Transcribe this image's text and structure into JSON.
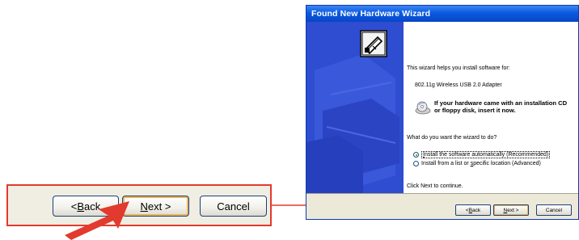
{
  "callout": {
    "back": {
      "pre": "< ",
      "mn": "B",
      "rest": "ack"
    },
    "next": {
      "mn": "N",
      "rest": "ext >"
    },
    "cancel": "Cancel"
  },
  "wizard": {
    "title": "Found New Hardware Wizard",
    "intro": "This wizard helps you install software for:",
    "device": "802.11g Wireless USB 2.0 Adapter",
    "cd_line1": "If your hardware came with an installation CD",
    "cd_line2": "or floppy disk, insert it now.",
    "question": "What do you want the wizard to do?",
    "options": [
      {
        "pre": "",
        "mn": "I",
        "rest": "nstall the software automatically (Recommended)",
        "selected": true
      },
      {
        "pre": "Install from a list or ",
        "mn": "s",
        "rest": "pecific location (Advanced)",
        "selected": false
      }
    ],
    "continue": "Click Next to continue.",
    "buttons": {
      "back": {
        "pre": "< ",
        "mn": "B",
        "rest": "ack"
      },
      "next": {
        "mn": "N",
        "rest": "ext >"
      },
      "cancel": "Cancel"
    }
  },
  "colors": {
    "callout_border": "#e23a2e",
    "titlebar": "#0a5ae0",
    "side_panel": "#2f4dd0",
    "arrow": "#e23a2e"
  },
  "icons": [
    "hardware-icon",
    "cd-icon",
    "pointer-arrow-icon",
    "connector-arrow-icon"
  ]
}
